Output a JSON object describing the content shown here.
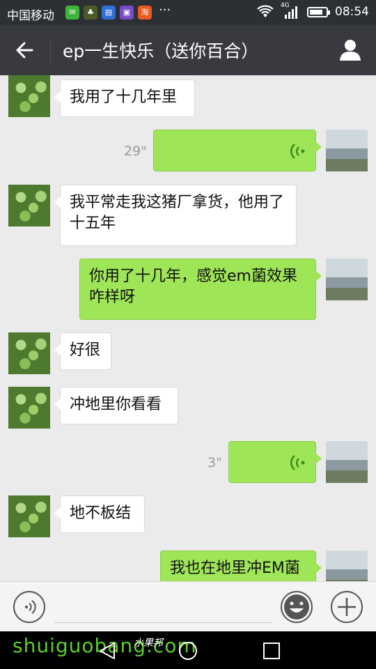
{
  "status_bar": {
    "carrier": "中国移动",
    "notifications": [
      "wechat-icon",
      "game-icon",
      "calendar-icon",
      "media-icon",
      "taobao-icon"
    ],
    "more": "···",
    "network": "4G",
    "time": "08:54",
    "battery_level": 0.8
  },
  "header": {
    "title": "ep一生快乐（送你百合）"
  },
  "messages": [
    {
      "side": "left",
      "text": "我用了十几年里"
    },
    {
      "side": "right",
      "type": "voice",
      "duration": "29\""
    },
    {
      "side": "left",
      "text": "我平常走我这猪厂拿货，他用了十五年"
    },
    {
      "side": "right",
      "text": "你用了十几年，感觉em菌效果咋样呀"
    },
    {
      "side": "left",
      "text": "好很"
    },
    {
      "side": "left",
      "text": "冲地里你看看"
    },
    {
      "side": "right",
      "type": "voice",
      "duration": "3\""
    },
    {
      "side": "left",
      "text": "地不板结"
    },
    {
      "side": "right",
      "text": "我也在地里冲EM菌"
    }
  ],
  "input_bar": {
    "voice_icon": "voice-mode-icon",
    "emoji_icon": "emoji-icon",
    "plus_icon": "plus-icon"
  },
  "nav_bar": {
    "watermark": "shuiguobang.com",
    "watermark_cn": "水果邦"
  },
  "colors": {
    "title_bg": "#393a3f",
    "chat_bg": "#ebebeb",
    "sent_bubble": "#9fe558",
    "received_bubble": "#ffffff",
    "watermark": "#5bcf2b"
  }
}
